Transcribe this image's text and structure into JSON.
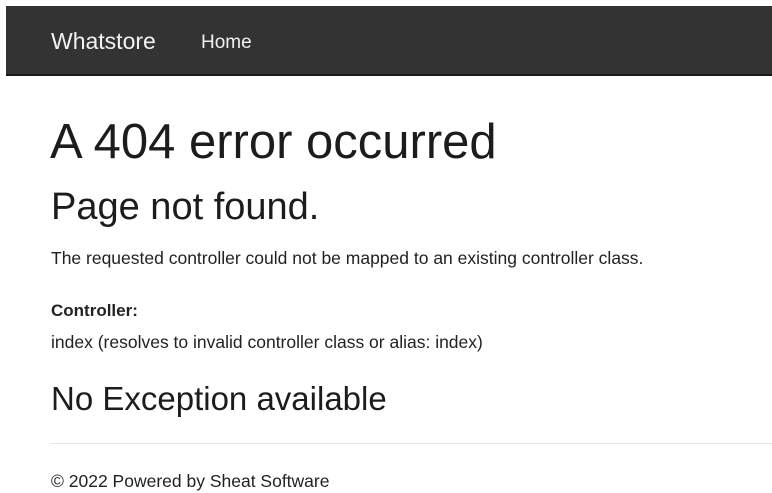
{
  "navbar": {
    "brand": "Whatstore",
    "links": [
      {
        "label": "Home"
      }
    ],
    "background_color": "#333333",
    "text_color": "#f2f2f2"
  },
  "main": {
    "title": "A 404 error occurred",
    "subtitle": "Page not found.",
    "message": "The requested controller could not be mapped to an existing controller class.",
    "controller_label": "Controller:",
    "controller_value": "index (resolves to invalid controller class or alias: index)",
    "exception_heading": "No Exception available"
  },
  "footer": {
    "text": "© 2022 Powered by Sheat Software"
  }
}
